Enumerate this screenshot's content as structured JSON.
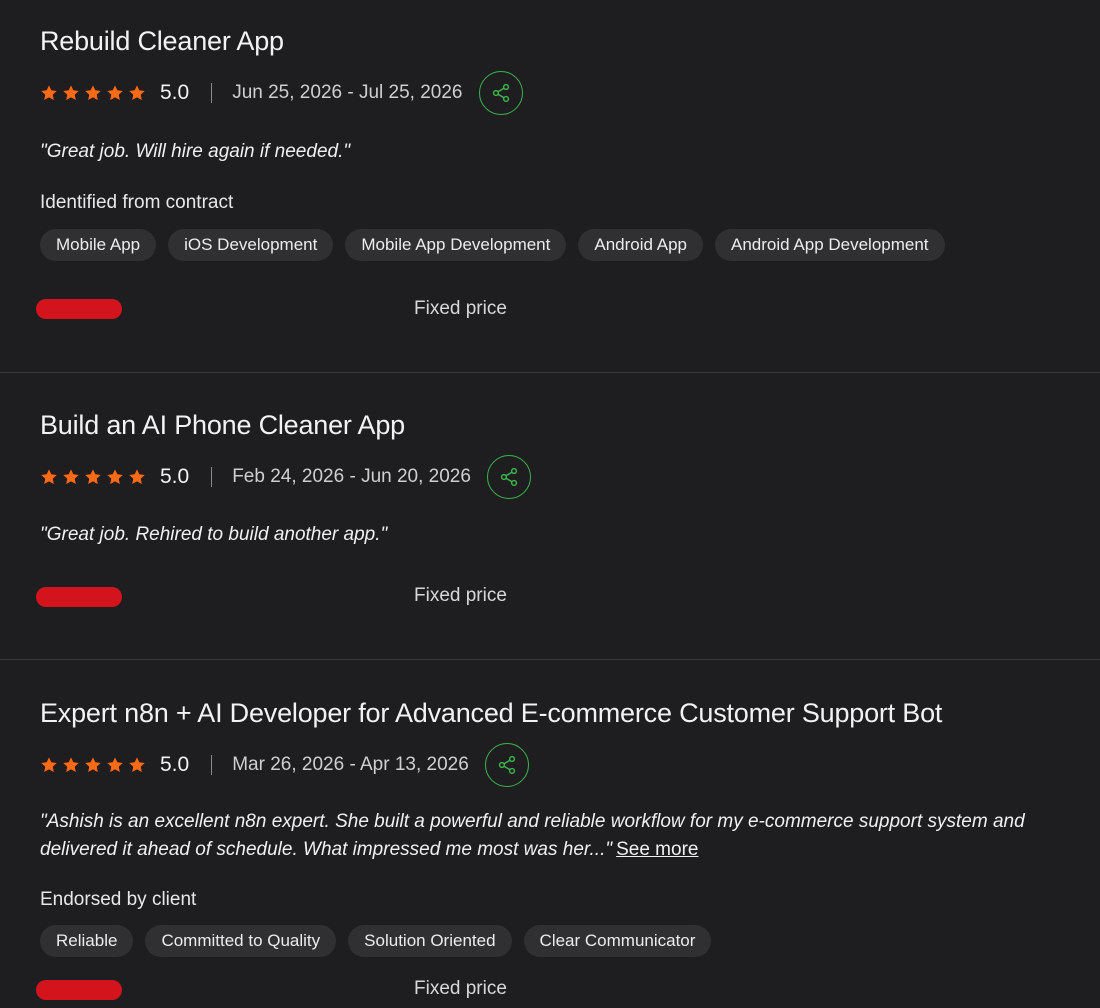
{
  "colors": {
    "background": "#1e1e20",
    "star": "#ff6a13",
    "share_border": "#3bb54a",
    "chip_bg": "#303033",
    "redaction": "#d4141d"
  },
  "icons": {
    "star": "star-icon",
    "share": "share-icon"
  },
  "jobs": [
    {
      "title": "Rebuild Cleaner App",
      "rating": "5.0",
      "stars": 5,
      "dates": "Jun 25, 2026 - Jul 25, 2026",
      "review": "\"Great job. Will hire again if needed.\"",
      "section_label": "Identified from contract",
      "tags": [
        "Mobile App",
        "iOS Development",
        "Mobile App Development",
        "Android App",
        "Android App Development"
      ],
      "contract_type": "Fixed price"
    },
    {
      "title": "Build an AI Phone Cleaner App",
      "rating": "5.0",
      "stars": 5,
      "dates": "Feb 24, 2026 - Jun 20, 2026",
      "review": "\"Great job. Rehired to build another app.\"",
      "contract_type": "Fixed price"
    },
    {
      "title": "Expert n8n + AI Developer for Advanced E-commerce Customer Support Bot",
      "rating": "5.0",
      "stars": 5,
      "dates": "Mar 26, 2026 - Apr 13, 2026",
      "review": "\"Ashish is an excellent n8n expert. She built a powerful and reliable workflow for my e-commerce support system and delivered it ahead of schedule. What impressed me most was her...\"",
      "see_more": "See more",
      "section_label": "Endorsed by client",
      "tags": [
        "Reliable",
        "Committed to Quality",
        "Solution Oriented",
        "Clear Communicator"
      ],
      "contract_type": "Fixed price"
    }
  ]
}
